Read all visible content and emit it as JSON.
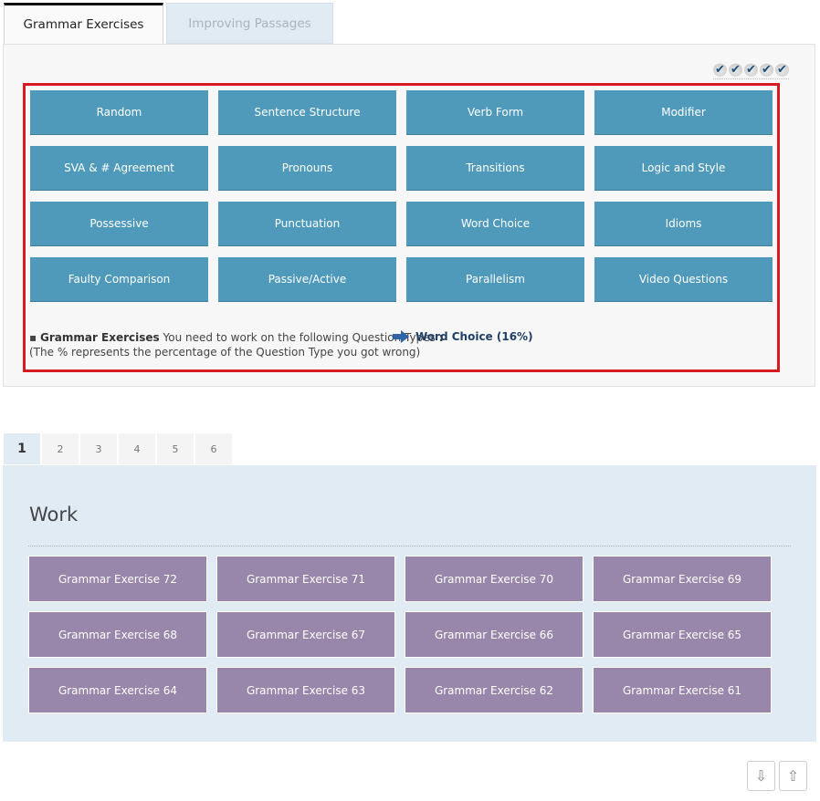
{
  "tabs": [
    {
      "label": "Grammar Exercises",
      "active": true
    },
    {
      "label": "Improving Passages",
      "active": false
    }
  ],
  "progress_checks": {
    "icon": "checkmark-icon",
    "count": 5,
    "glyph": "✔"
  },
  "question_types": [
    "Random",
    "Sentence Structure",
    "Verb Form",
    "Modifier",
    "SVA & # Agreement",
    "Pronouns",
    "Transitions",
    "Logic and Style",
    "Possessive",
    "Punctuation",
    "Word Choice",
    "Idioms",
    "Faulty Comparison",
    "Passive/Active",
    "Parallelism",
    "Video Questions"
  ],
  "recommendation": {
    "bullet": "▪",
    "title": "Grammar Exercises",
    "text": "You need to work on the following Question Types",
    "colon": ":",
    "note": "(The % represents the percentage of the Question Type you got wrong)",
    "link_label": "Word Choice (16%)"
  },
  "pagination": {
    "pages": [
      "1",
      "2",
      "3",
      "4",
      "5",
      "6"
    ],
    "current": "1"
  },
  "work": {
    "title": "Work",
    "exercises": [
      "Grammar Exercise 72",
      "Grammar Exercise 71",
      "Grammar Exercise 70",
      "Grammar Exercise 69",
      "Grammar Exercise 68",
      "Grammar Exercise 67",
      "Grammar Exercise 66",
      "Grammar Exercise 65",
      "Grammar Exercise 64",
      "Grammar Exercise 63",
      "Grammar Exercise 62",
      "Grammar Exercise 61"
    ]
  },
  "scroll_buttons": {
    "down": "⇩",
    "up": "⇧"
  },
  "colors": {
    "question_button": "#4f9abb",
    "work_button": "#9887aa",
    "highlight_border": "#d71920",
    "link": "#1f3f66"
  }
}
